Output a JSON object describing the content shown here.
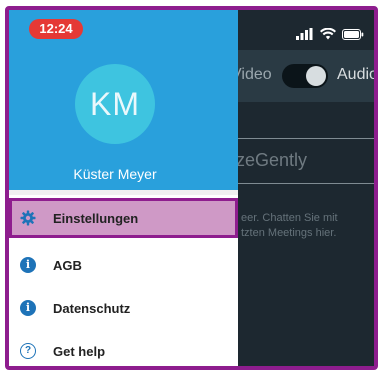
{
  "status_bar": {
    "time": "12:24",
    "signal_icon": "signal-icon",
    "wifi_icon": "wifi-icon",
    "battery_icon": "battery-icon"
  },
  "drawer": {
    "avatar_initials": "KM",
    "user_name": "Küster Meyer",
    "items": [
      {
        "label": "Einstellungen",
        "icon": "gear-icon",
        "active": true
      },
      {
        "label": "AGB",
        "icon": "info-icon",
        "active": false
      },
      {
        "label": "Datenschutz",
        "icon": "info-icon",
        "active": false
      },
      {
        "label": "Get help",
        "icon": "help-icon",
        "active": false
      }
    ]
  },
  "background": {
    "video_label": "Video",
    "audio_label": "Audio",
    "meeting_input_value": "zeGently",
    "empty_hint_line1": "eer. Chatten Sie mit",
    "empty_hint_line2": "tzten Meetings hier."
  },
  "colors": {
    "drawer_header": "#29a0dc",
    "avatar": "#3ec4e0",
    "highlight_border": "#8e1d8e",
    "highlight_fill": "#cf99c6",
    "time_pill": "#e53935",
    "icon_blue": "#1e73b8"
  }
}
